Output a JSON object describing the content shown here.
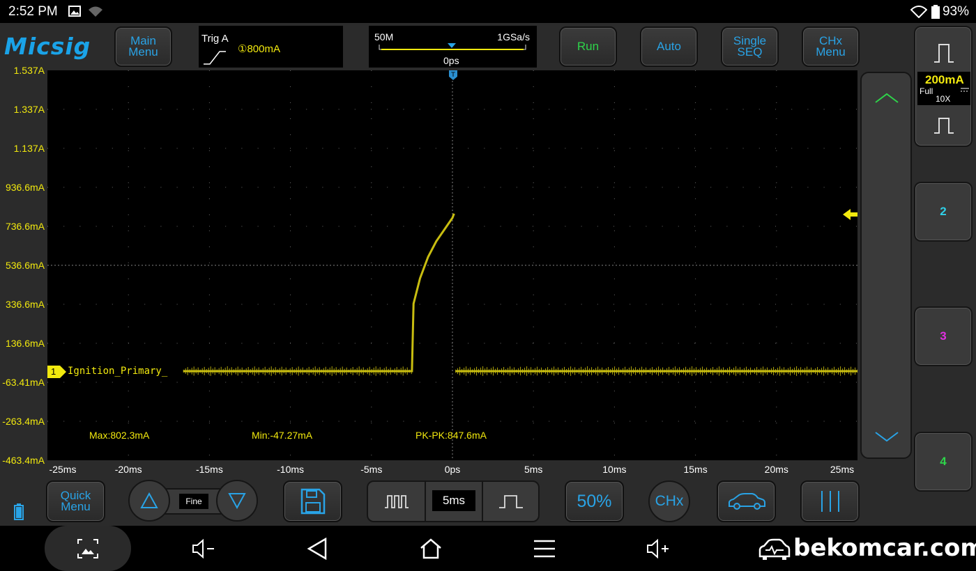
{
  "status_bar": {
    "time": "2:52 PM",
    "battery": "93%",
    "icons": [
      "image-icon",
      "signal-icon",
      "wifi-icon",
      "battery-icon"
    ]
  },
  "app": {
    "logo": "Micsig"
  },
  "top_bar": {
    "main_menu": "Main Menu",
    "trigger": {
      "label": "Trig A",
      "level": "①800mA"
    },
    "timebase": {
      "memory": "50M",
      "sample_rate": "1GSa/s",
      "position": "0ps"
    },
    "run": "Run",
    "auto": "Auto",
    "single_seq": "Single SEQ",
    "chx_menu": "CHx Menu"
  },
  "y_axis": [
    "1.537A",
    "1.337A",
    "1.137A",
    "936.6mA",
    "736.6mA",
    "536.6mA",
    "336.6mA",
    "136.6mA",
    "-63.41mA",
    "-263.4mA",
    "-463.4mA"
  ],
  "x_axis": [
    "-25ms",
    "-20ms",
    "-15ms",
    "-10ms",
    "-5ms",
    "0ps",
    "5ms",
    "10ms",
    "15ms",
    "20ms",
    "25ms"
  ],
  "channel": {
    "number": "1",
    "name": "Ignition_Primary_",
    "color": "#c8bd10",
    "scale": "200mA",
    "coupling": "Full",
    "probe": "10X"
  },
  "measurements": {
    "max": "Max:802.3mA",
    "min": "Min:-47.27mA",
    "pkpk": "PK-PK:847.6mA"
  },
  "right_panel": {
    "ch2": "2",
    "ch3": "3",
    "ch4": "4",
    "ch2_color": "#2fd0e8",
    "ch3_color": "#e030e0",
    "ch4_color": "#2ed44a"
  },
  "bottom_bar": {
    "quick_menu": "Quick Menu",
    "fine": "Fine",
    "timebase": "5ms",
    "fifty_percent": "50%",
    "chx": "CHx"
  },
  "watermark": "bekomcar.com",
  "chart_data": {
    "type": "line",
    "xlabel": "",
    "ylabel": "",
    "xlim": [
      -25,
      25
    ],
    "ylim": [
      -463.4,
      1537
    ],
    "series": [
      {
        "x": [
          -16.6,
          -2.5,
          -2.4,
          -2.0,
          -1.5,
          -1.0,
          0.0,
          0.1,
          0.2,
          25.0
        ],
        "y": [
          -6,
          -6,
          340,
          470,
          580,
          660,
          780,
          802,
          -6,
          -6
        ]
      }
    ]
  }
}
